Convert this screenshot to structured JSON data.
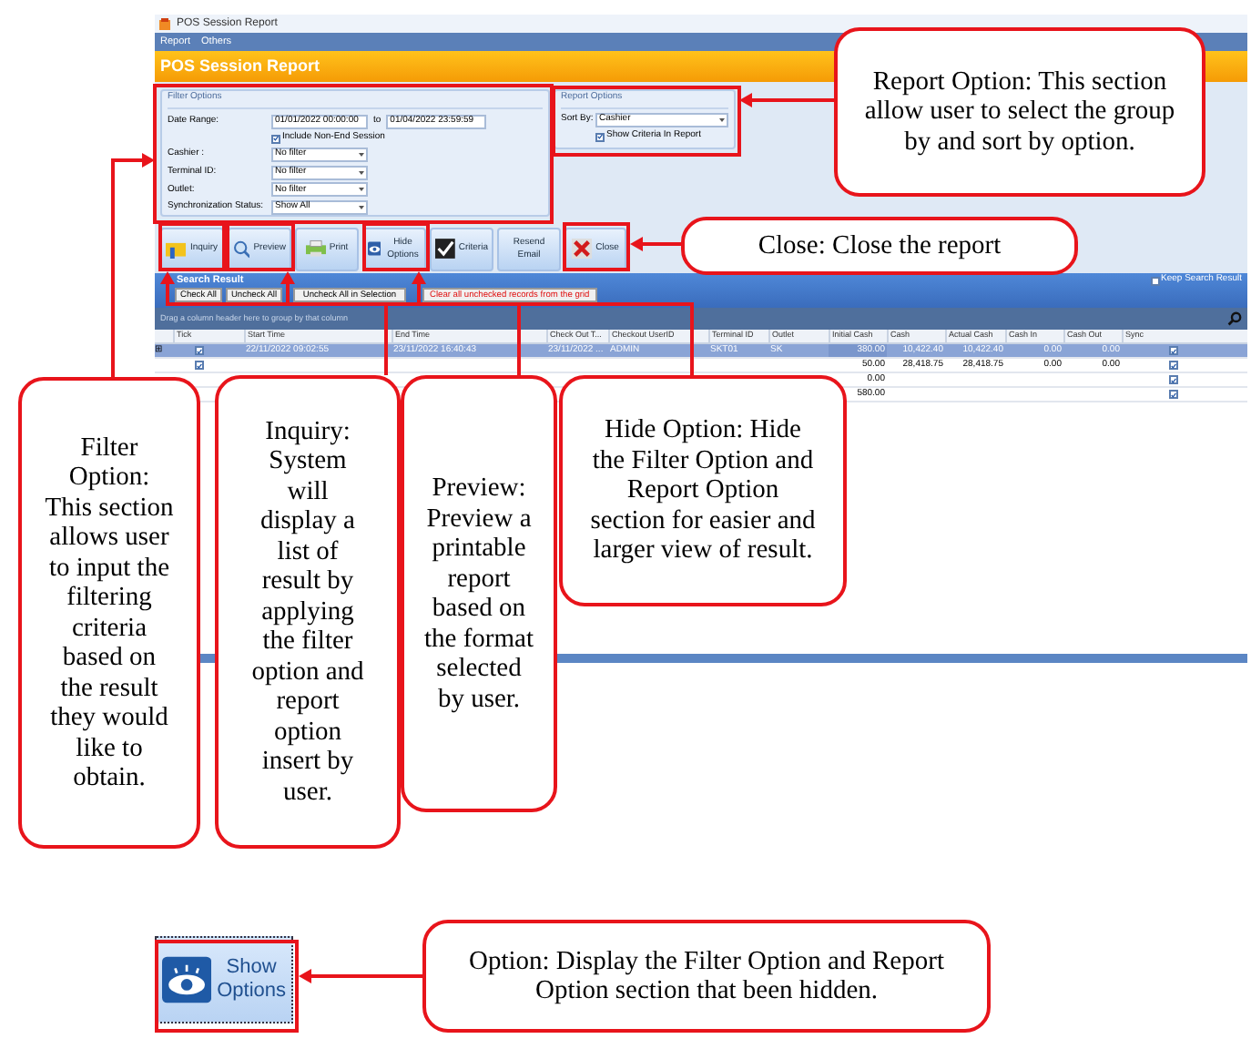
{
  "window": {
    "title": "POS Session Report"
  },
  "menu": [
    "Report",
    "Others"
  ],
  "header": "POS Session Report",
  "filter_options": {
    "title": "Filter Options",
    "date_label": "Date Range:",
    "date_from": "01/01/2022 00:00:00",
    "to_label": "to",
    "date_to": "01/04/2022 23:59:59",
    "include_non_end": {
      "label": "Include Non-End Session",
      "checked": true
    },
    "fields": [
      {
        "label": "Cashier :",
        "value": "No filter"
      },
      {
        "label": "Terminal ID:",
        "value": "No filter"
      },
      {
        "label": "Outlet:",
        "value": "No filter"
      },
      {
        "label": "Synchronization Status:",
        "value": "Show All"
      }
    ]
  },
  "report_options": {
    "title": "Report Options",
    "sort_label": "Sort By:",
    "sort_value": "Cashier",
    "show_criteria": {
      "label": "Show Criteria In Report",
      "checked": true
    }
  },
  "toolbar": [
    {
      "kind": "inquiry",
      "label": "Inquiry"
    },
    {
      "kind": "preview",
      "label": "Preview"
    },
    {
      "kind": "print",
      "label": "Print"
    },
    {
      "kind": "hide",
      "label": "Hide Options"
    },
    {
      "kind": "criteria",
      "label": "Criteria"
    },
    {
      "kind": "email",
      "label": "Resend Email"
    },
    {
      "kind": "close",
      "label": "Close"
    }
  ],
  "search_result": {
    "title": "Search Result",
    "keep": {
      "label": "Keep Search Result",
      "checked": false
    },
    "buttons": [
      "Check All",
      "Uncheck All",
      "Uncheck All in Selection"
    ],
    "clear_button": "Clear all unchecked records from the grid",
    "group_hint": "Drag a column header here to group by that column"
  },
  "table": {
    "tick_column": "Tick",
    "columns": [
      "Start Time",
      "End Time",
      "Check Out T...",
      "Checkout UserID",
      "Terminal ID",
      "Outlet",
      "Initial Cash",
      "Cash",
      "Actual Cash",
      "Cash In",
      "Cash Out",
      "Sync"
    ],
    "rows": [
      {
        "selected": true,
        "expander": "⊞",
        "checked": true,
        "cells": [
          "22/11/2022 09:02:55",
          "23/11/2022 16:40:43",
          "23/11/2022 ...",
          "ADMIN",
          "SKT01",
          "SK",
          "380.00",
          "10,422.40",
          "10,422.40",
          "0.00",
          "0.00"
        ],
        "sync": true
      },
      {
        "selected": false,
        "checked": true,
        "cells": [
          null,
          null,
          null,
          null,
          null,
          null,
          "50.00",
          "28,418.75",
          "28,418.75",
          "0.00",
          "0.00"
        ],
        "sync": true
      },
      {
        "selected": false,
        "cells": [
          null,
          null,
          null,
          null,
          null,
          null,
          "0.00",
          null,
          null,
          null,
          null
        ],
        "sync": true
      },
      {
        "selected": false,
        "cells": [
          null,
          null,
          null,
          null,
          null,
          null,
          "580.00",
          null,
          null,
          null,
          null
        ],
        "sync": true
      }
    ]
  },
  "callouts": [
    "Report Option: This section allow user to select the group by and sort by option.",
    "Close: Close the report",
    "Filter Option: This section allows user to input the filtering criteria based on the result they would like to obtain.",
    "Inquiry: System will display a list of result by applying the filter option and report option insert by user.",
    "Preview: Preview a printable report based on the format selected by user.",
    "Hide Option: Hide the Filter Option and Report Option section for easier and larger view of result.",
    "Option: Display the Filter Option and Report Option section that been hidden."
  ],
  "show_options_button": {
    "label": "Show Options"
  }
}
